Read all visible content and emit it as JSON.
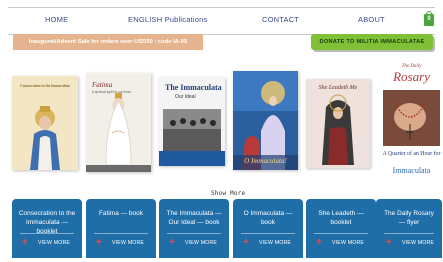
{
  "nav": {
    "items": [
      "HOME",
      "ENGLISH Publications",
      "CONTACT",
      "ABOUT"
    ],
    "cart_count": "0",
    "cart_icon": "shopping-bag-icon"
  },
  "promo": {
    "text": "Inaugural/Advent Sale for orders over USD50 : code IA-05"
  },
  "donate": {
    "label": "DONATE TO MILITIA IMMACULATAE"
  },
  "books": [
    {
      "cover_title": "Consecration to the Immaculata",
      "cover_subtitle": "Consecration to the Immaculata",
      "cover_color": "#f3e6c5"
    },
    {
      "cover_title": "Fatima",
      "cover_subtitle": "A spiritual light for our times",
      "cover_color": "#f2efe8"
    },
    {
      "cover_title": "The Immaculata",
      "cover_subtitle": "Our Ideal",
      "cover_color": "#f4f4f4"
    },
    {
      "cover_title": "O Immaculata!",
      "cover_subtitle": "",
      "cover_color": "#2b5f9e"
    },
    {
      "cover_title": "She Leadeth Me",
      "cover_subtitle": "",
      "cover_color": "#efe2dc"
    },
    {
      "cover_title": "Rosary",
      "cover_subtitle": "The Daily",
      "cover_color": "#ffffff",
      "cover_extra": "A Quarter of an Hour for",
      "cover_extra2": "Immaculata"
    }
  ],
  "show_more": "Show More",
  "panels": [
    {
      "title": "Consecration to the Immaculata — booklet",
      "action": "VIEW MORE"
    },
    {
      "title": "Fatima — book",
      "action": "VIEW MORE"
    },
    {
      "title": "The Immaculata — Our Ideal — book",
      "action": "VIEW MORE"
    },
    {
      "title": "O Immaculata — book",
      "action": "VIEW MORE"
    },
    {
      "title": "She Leadeth — booklet",
      "action": "VIEW MORE"
    },
    {
      "title": "The Daily Rosary — flyer",
      "action": "VIEW MORE"
    }
  ],
  "colors": {
    "nav_text": "#3a4a8a",
    "promo_bg": "#e5b48e",
    "donate_bg": "#7fc036",
    "panel_bg": "#1f6ea8",
    "plus": "#e84b4b"
  }
}
